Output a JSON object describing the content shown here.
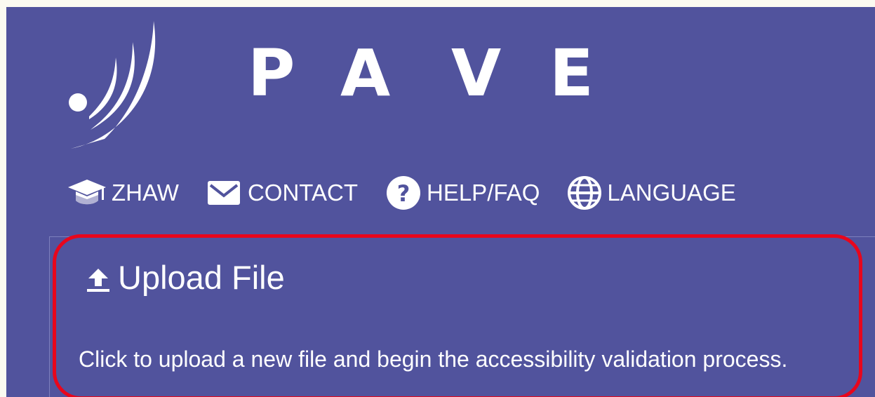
{
  "brand": {
    "title": "PAVE",
    "letters": [
      "P",
      "A",
      "V",
      "E"
    ]
  },
  "nav": {
    "items": [
      {
        "label": "ZHAW",
        "icon": "graduation-cap-icon"
      },
      {
        "label": "CONTACT",
        "icon": "envelope-icon"
      },
      {
        "label": "HELP/FAQ",
        "icon": "question-circle-icon"
      },
      {
        "label": "LANGUAGE",
        "icon": "globe-icon"
      }
    ]
  },
  "upload": {
    "heading": "Upload File",
    "icon": "upload-icon",
    "description": "Click to upload a new file and begin the accessibility validation process."
  },
  "colors": {
    "background": "#51539d",
    "text": "#ffffff",
    "highlight": "#e8061c",
    "outer": "#fbfaf1"
  }
}
